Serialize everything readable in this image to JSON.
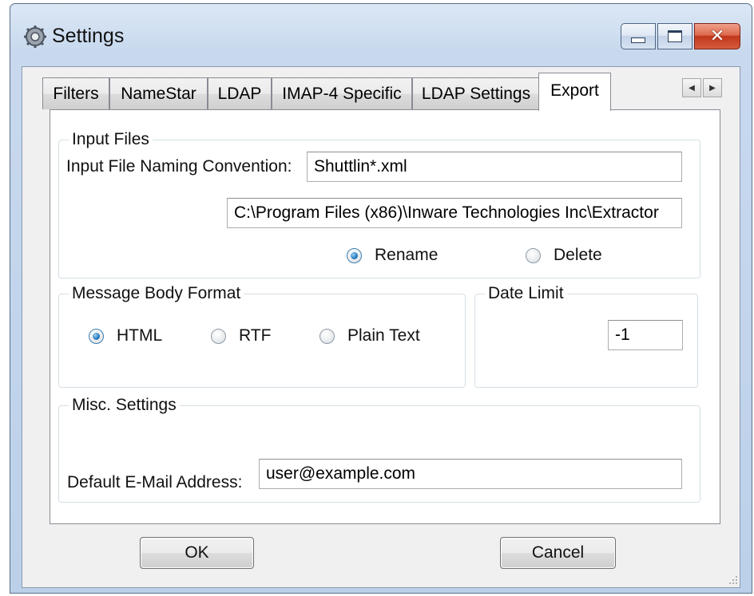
{
  "window": {
    "title": "Settings"
  },
  "caption": {
    "close_symbol": "✕"
  },
  "tabs": [
    {
      "label": "Filters"
    },
    {
      "label": "NameStar"
    },
    {
      "label": "LDAP"
    },
    {
      "label": "IMAP-4 Specific"
    },
    {
      "label": "LDAP Settings"
    },
    {
      "label": "Export",
      "active": true
    }
  ],
  "tab_scroll": {
    "left": "◀",
    "right": "▶"
  },
  "input_files": {
    "legend": "Input Files",
    "naming_label": "Input File Naming Convention:",
    "naming_value": "Shuttlin*.xml",
    "path_value": "C:\\Program Files (x86)\\Inware Technologies Inc\\Extractor",
    "rename_label": "Rename",
    "delete_label": "Delete",
    "selected": "Rename"
  },
  "message_body": {
    "legend": "Message Body Format",
    "html_label": "HTML",
    "rtf_label": "RTF",
    "plain_label": "Plain Text",
    "selected": "HTML"
  },
  "date_limit": {
    "legend": "Date Limit",
    "value": "-1"
  },
  "misc": {
    "legend": "Misc. Settings",
    "email_label": "Default E-Mail Address:",
    "email_value": "user@example.com"
  },
  "buttons": {
    "ok": "OK",
    "cancel": "Cancel"
  },
  "colors": {
    "titlebar": "#c8d9ee",
    "close_button": "#c3371b",
    "dialog_bg": "#f0f0f0",
    "accent_radio": "#2b7fc3"
  }
}
